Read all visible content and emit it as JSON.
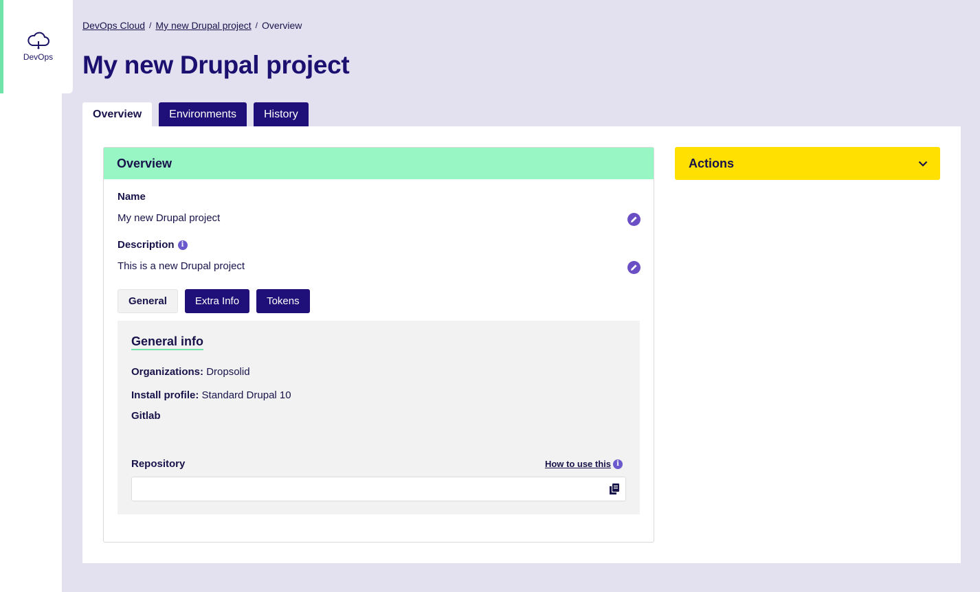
{
  "sidebar": {
    "items": [
      {
        "label": "DevOps",
        "icon": "cloud-icon"
      }
    ]
  },
  "breadcrumb": {
    "items": [
      "DevOps Cloud",
      "My new Drupal project"
    ],
    "current": "Overview",
    "separator": "/"
  },
  "page": {
    "title": "My new Drupal project"
  },
  "tabs": [
    {
      "label": "Overview",
      "active": true
    },
    {
      "label": "Environments"
    },
    {
      "label": "History"
    }
  ],
  "overview": {
    "header": "Overview",
    "name_label": "Name",
    "name_value": "My new Drupal project",
    "description_label": "Description",
    "description_value": "This is a new Drupal project",
    "subtabs": [
      {
        "label": "General",
        "active": true
      },
      {
        "label": "Extra Info"
      },
      {
        "label": "Tokens"
      }
    ],
    "general": {
      "title": "General info",
      "organizations_label": "Organizations:",
      "organizations_value": "Dropsolid",
      "install_profile_label": "Install profile:",
      "install_profile_value": "Standard Drupal 10",
      "gitlab_label": "Gitlab",
      "repository_label": "Repository",
      "how_to_label": "How to use this",
      "repository_value": ""
    }
  },
  "actions": {
    "label": "Actions"
  },
  "colors": {
    "primary": "#1f0f78",
    "accent_green": "#98f5c4",
    "accent_yellow": "#ffe000",
    "background": "#e3e0f0"
  }
}
